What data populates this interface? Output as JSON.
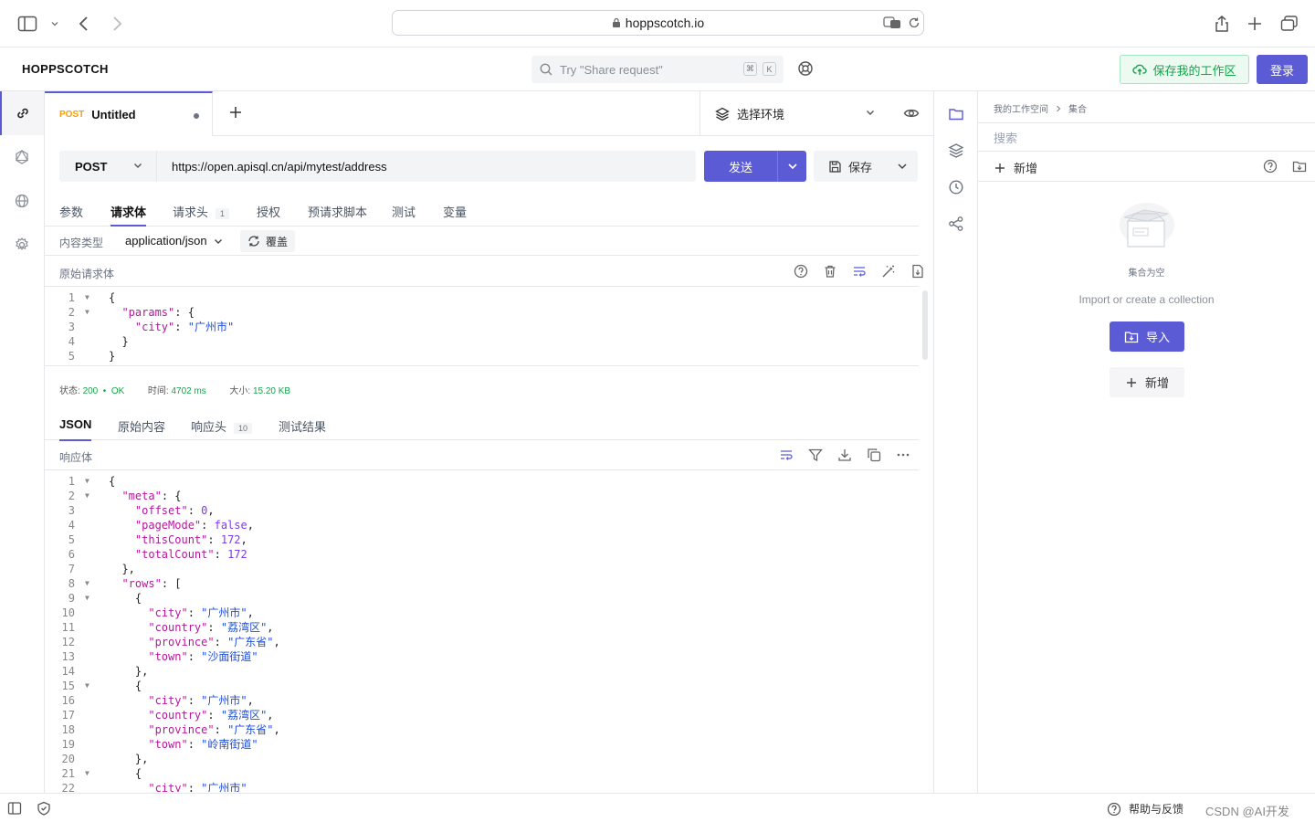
{
  "browser": {
    "url": "hoppscotch.io"
  },
  "header": {
    "brand": "HOPPSCOTCH",
    "search_placeholder": "Try \"Share request\"",
    "kbd_cmd": "⌘",
    "kbd_k": "K",
    "save_workspace": "保存我的工作区",
    "login": "登录"
  },
  "request_tab": {
    "method": "POST",
    "title": "Untitled",
    "environment": "选择环境"
  },
  "request": {
    "method": "POST",
    "url": "https://open.apisql.cn/api/mytest/address",
    "send": "发送",
    "save": "保存"
  },
  "request_tabs": [
    {
      "label": "参数"
    },
    {
      "label": "请求体"
    },
    {
      "label": "请求头",
      "badge": "1"
    },
    {
      "label": "授权"
    },
    {
      "label": "预请求脚本"
    },
    {
      "label": "测试"
    },
    {
      "label": "变量"
    }
  ],
  "body": {
    "content_type_label": "内容类型",
    "content_type": "application/json",
    "override": "覆盖",
    "raw_label": "原始请求体",
    "lines": [
      "{",
      "  \"params\": {",
      "    \"city\": \"广州市\"",
      "  }",
      "}"
    ]
  },
  "response": {
    "status_label": "状态:",
    "status_code": "200",
    "status_text": "OK",
    "time_label": "时间:",
    "time": "4702 ms",
    "size_label": "大小:",
    "size": "15.20 KB",
    "tabs": [
      {
        "label": "JSON"
      },
      {
        "label": "原始内容"
      },
      {
        "label": "响应头",
        "badge": "10"
      },
      {
        "label": "测试结果"
      }
    ],
    "body_label": "响应体",
    "lines": [
      "{",
      "  \"meta\": {",
      "    \"offset\": 0,",
      "    \"pageMode\": false,",
      "    \"thisCount\": 172,",
      "    \"totalCount\": 172",
      "  },",
      "  \"rows\": [",
      "    {",
      "      \"city\": \"广州市\",",
      "      \"country\": \"荔湾区\",",
      "      \"province\": \"广东省\",",
      "      \"town\": \"沙面街道\"",
      "    },",
      "    {",
      "      \"city\": \"广州市\",",
      "      \"country\": \"荔湾区\",",
      "      \"province\": \"广东省\",",
      "      \"town\": \"岭南街道\"",
      "    },",
      "    {",
      "      \"city\": \"广州市\""
    ]
  },
  "collections": {
    "breadcrumb_root": "我的工作空间",
    "breadcrumb_current": "集合",
    "search_placeholder": "搜索",
    "new": "新增",
    "empty_label": "集合为空",
    "empty_hint": "Import or create a collection",
    "import": "导入",
    "empty_new": "新增"
  },
  "footer": {
    "help": "帮助与反馈",
    "watermark": "CSDN @AI开发"
  },
  "colors": {
    "accent": "#5b5bd6",
    "success": "#16a34a",
    "method_post": "#f59e0b"
  }
}
